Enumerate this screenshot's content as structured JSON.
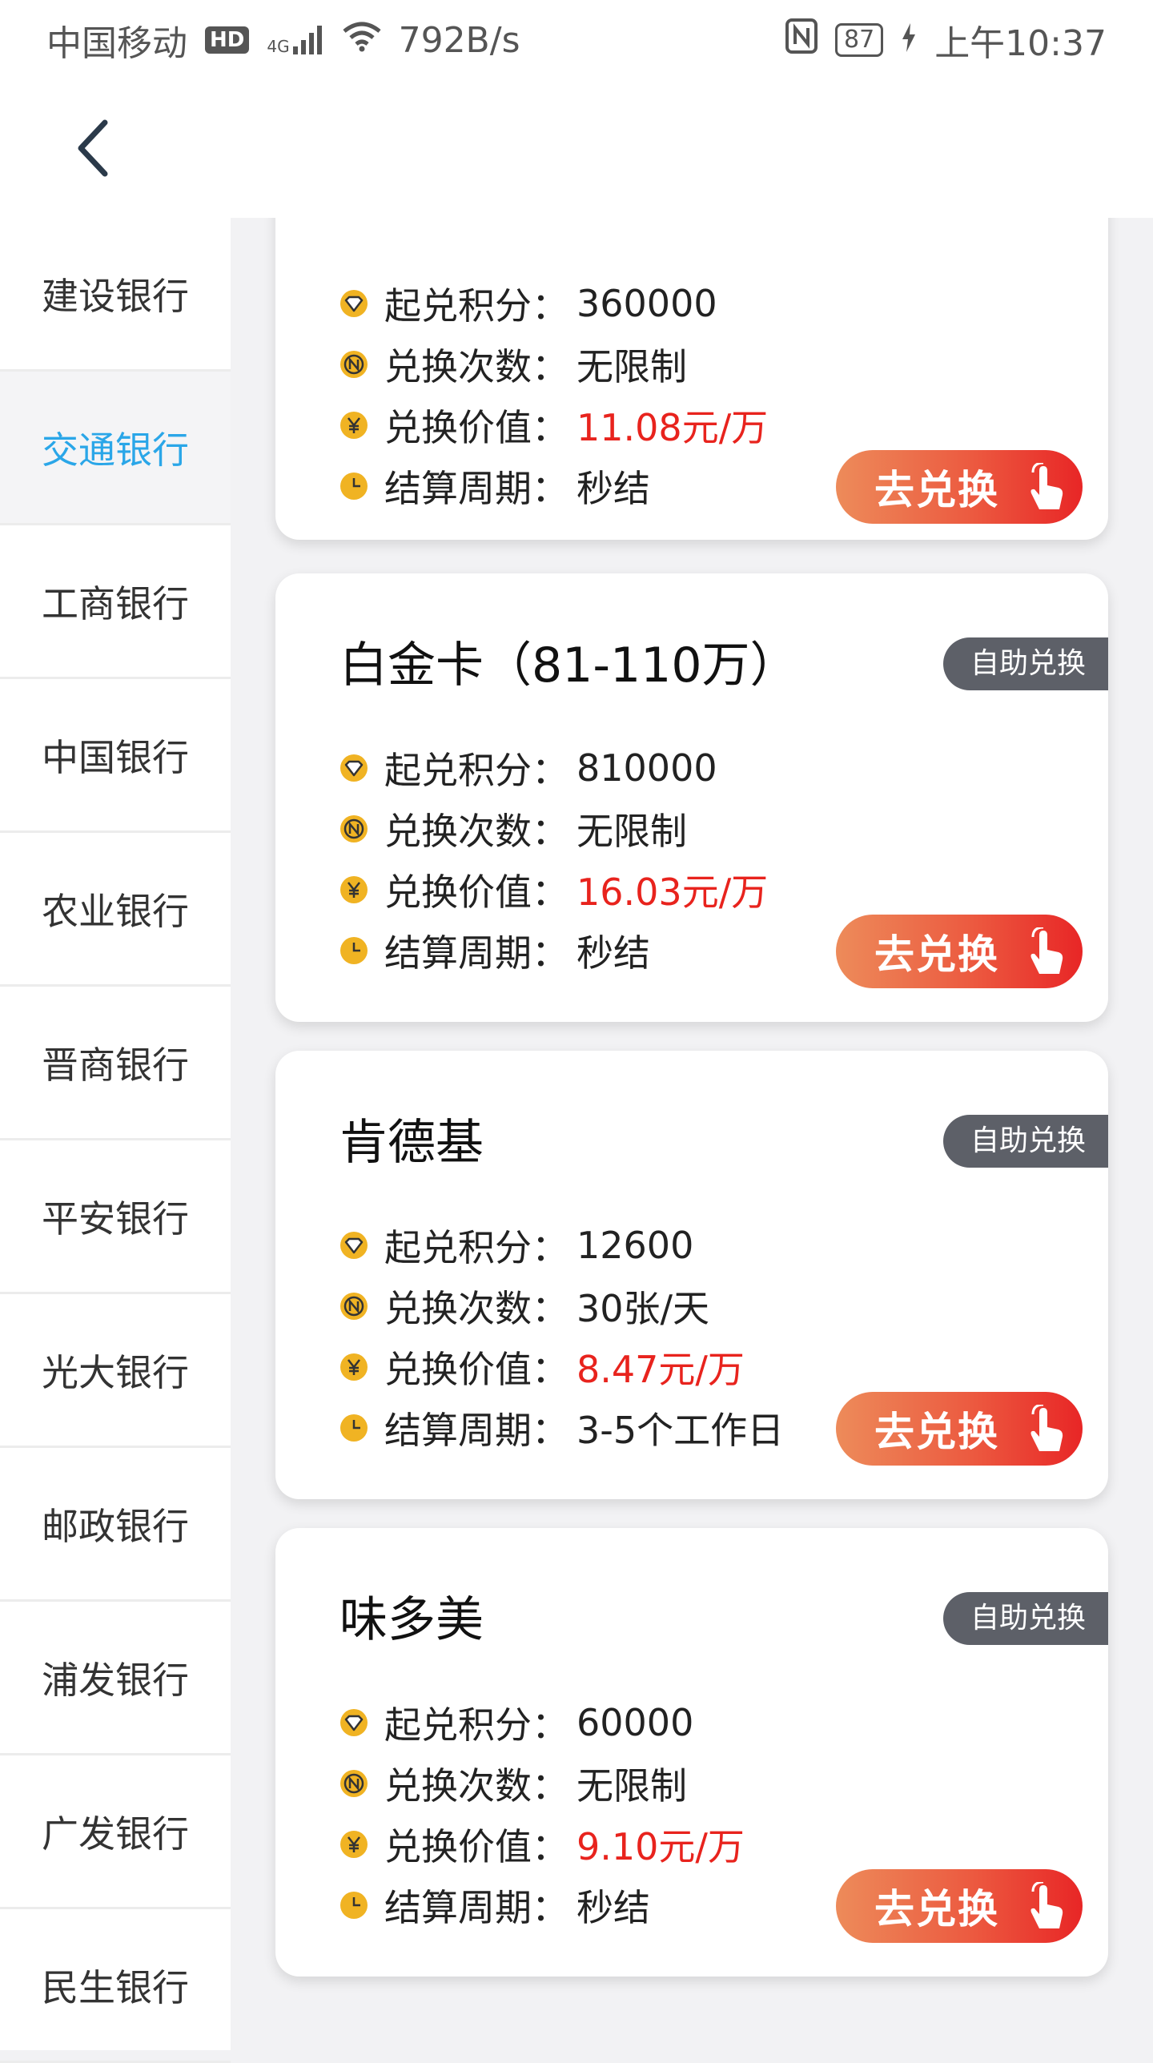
{
  "status_bar": {
    "carrier": "中国移动",
    "hd": "HD",
    "network": "4G",
    "speed": "792B/s",
    "battery": "87",
    "time": "上午10:37"
  },
  "sidebar": {
    "items": [
      {
        "label": "建设银行",
        "active": false
      },
      {
        "label": "交通银行",
        "active": true
      },
      {
        "label": "工商银行",
        "active": false
      },
      {
        "label": "中国银行",
        "active": false
      },
      {
        "label": "农业银行",
        "active": false
      },
      {
        "label": "晋商银行",
        "active": false
      },
      {
        "label": "平安银行",
        "active": false
      },
      {
        "label": "光大银行",
        "active": false
      },
      {
        "label": "邮政银行",
        "active": false
      },
      {
        "label": "浦发银行",
        "active": false
      },
      {
        "label": "广发银行",
        "active": false
      },
      {
        "label": "民生银行",
        "active": false
      }
    ]
  },
  "labels": {
    "min_points": "起兑积分：",
    "exchange_times": "兑换次数：",
    "exchange_value": "兑换价值：",
    "settlement": "结算周期：",
    "exchange_button": "去兑换",
    "self_service_badge": "自助兑换"
  },
  "cards": [
    {
      "title": "",
      "min_points": "360000",
      "times": "无限制",
      "value": "11.08元/万",
      "settlement": "秒结"
    },
    {
      "title": "白金卡（81-110万）",
      "min_points": "810000",
      "times": "无限制",
      "value": "16.03元/万",
      "settlement": "秒结"
    },
    {
      "title": "肯德基",
      "min_points": "12600",
      "times": "30张/天",
      "value": "8.47元/万",
      "settlement": "3-5个工作日"
    },
    {
      "title": "味多美",
      "min_points": "60000",
      "times": "无限制",
      "value": "9.10元/万",
      "settlement": "秒结"
    }
  ],
  "colors": {
    "accent": "#2aa6e8",
    "value_red": "#e8231d",
    "button_gradient_start": "#ed8b5a",
    "button_gradient_end": "#e82626",
    "badge_bg": "#5d6068",
    "icon_gold": "#f0b323"
  },
  "icons": {
    "back": "chevron-left-icon",
    "points": "diamond-icon",
    "times": "n-coin-icon",
    "value": "yuan-coin-icon",
    "settlement": "clock-icon",
    "button": "tap-hand-icon"
  }
}
